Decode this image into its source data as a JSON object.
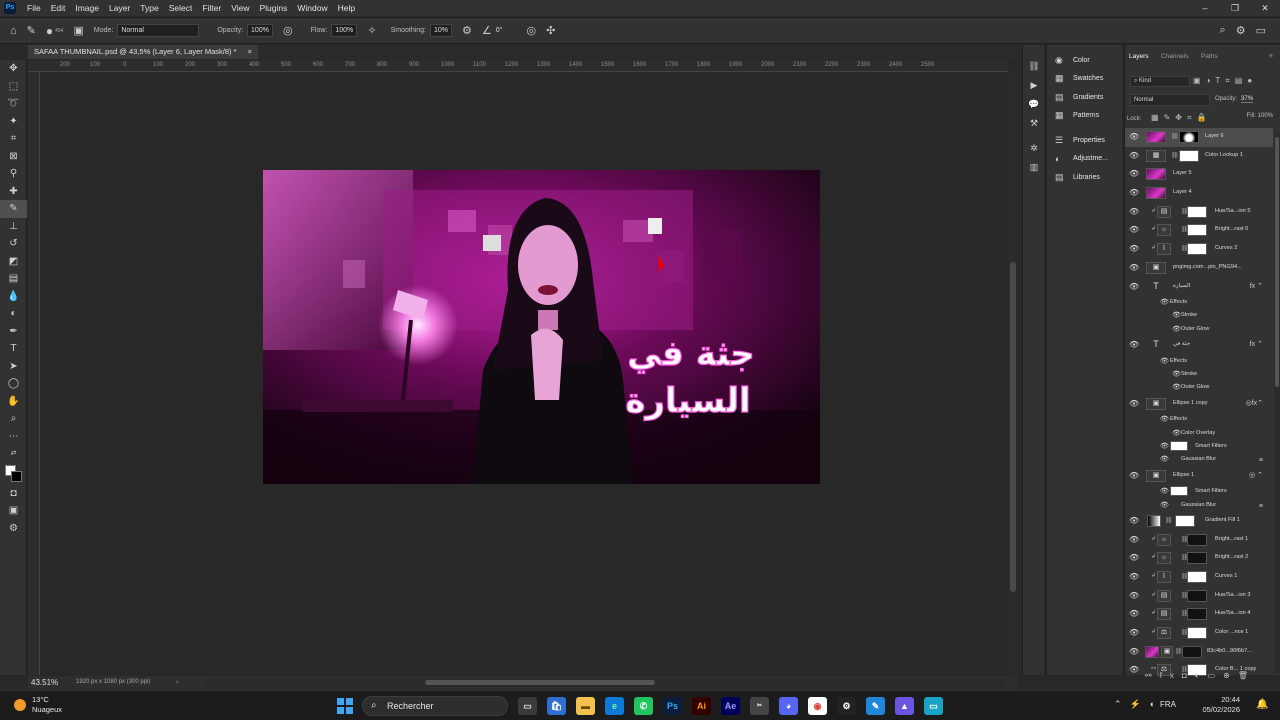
{
  "app": {
    "icon_text": "Ps",
    "menu": [
      "File",
      "Edit",
      "Image",
      "Layer",
      "Type",
      "Select",
      "Filter",
      "View",
      "Plugins",
      "Window",
      "Help"
    ]
  },
  "options": {
    "mode_label": "Mode:",
    "mode_value": "Normal",
    "opacity_label": "Opacity:",
    "opacity_value": "100%",
    "flow_label": "Flow:",
    "flow_value": "100%",
    "smoothing_label": "Smoothing:",
    "smoothing_value": "10%",
    "angle_value": "0°",
    "brush_size": "454"
  },
  "document": {
    "tab_title": "SAFAA THUMBNAIL.psd @ 43,5% (Layer 6, Layer Mask/8) *",
    "zoom": "43.51%",
    "info": "1920 px x 1080 px (300 ppi)",
    "ruler_marks": [
      "200",
      "100",
      "0",
      "100",
      "200",
      "300",
      "400",
      "500",
      "600",
      "700",
      "800",
      "900",
      "1000",
      "1100",
      "1200",
      "1300",
      "1400",
      "1500",
      "1600",
      "1700",
      "1800",
      "1900",
      "2000",
      "2100",
      "2200",
      "2300",
      "2400",
      "2500"
    ]
  },
  "thumbnail": {
    "title_line1": "جثة في",
    "title_line2": "السيارة"
  },
  "mid_panel": {
    "group1": [
      "Color",
      "Swatches",
      "Gradients",
      "Patterns"
    ],
    "group2": [
      "Properties",
      "Adjustme...",
      "Libraries"
    ]
  },
  "layers_panel": {
    "tabs": [
      "Layers",
      "Channels",
      "Paths"
    ],
    "kind": "Kind",
    "blend": "Normal",
    "opacity_label": "Opacity:",
    "opacity_value": "37%",
    "lock_label": "Lock:",
    "fill_label": "Fill:",
    "fill_value": "100%",
    "layers": [
      "Layer 6",
      "Color Lookup 1",
      "Layer 5",
      "Layer 4",
      "Hue/Sa...ion 5",
      "Bright...rast 6",
      "Curves 2",
      "pngimg.com...pin_PNG94...",
      "السيارة",
      "Effects",
      "Stroke",
      "Outer Glow",
      "جثة في",
      "Effects",
      "Stroke",
      "Outer Glow",
      "Ellipse 1 copy",
      "Effects",
      "Color Overlay",
      "Smart Filters",
      "Gaussian Blur",
      "Ellipse 1",
      "Smart Filters",
      "Gaussian Blur",
      "Gradient Fill 1",
      "Bright...rast 1",
      "Bright...rast 2",
      "Curves 1",
      "Hue/Sa...ion 3",
      "Hue/Sa...ion 4",
      "Color ...nce 1",
      "83c4b0...90f6b7...",
      "Color B... 1 copy"
    ]
  },
  "taskbar": {
    "temp": "13°C",
    "weather": "Nuageux",
    "search": "Rechercher",
    "lang": "FRA",
    "time": "20:44",
    "date": "05/02/2026"
  }
}
